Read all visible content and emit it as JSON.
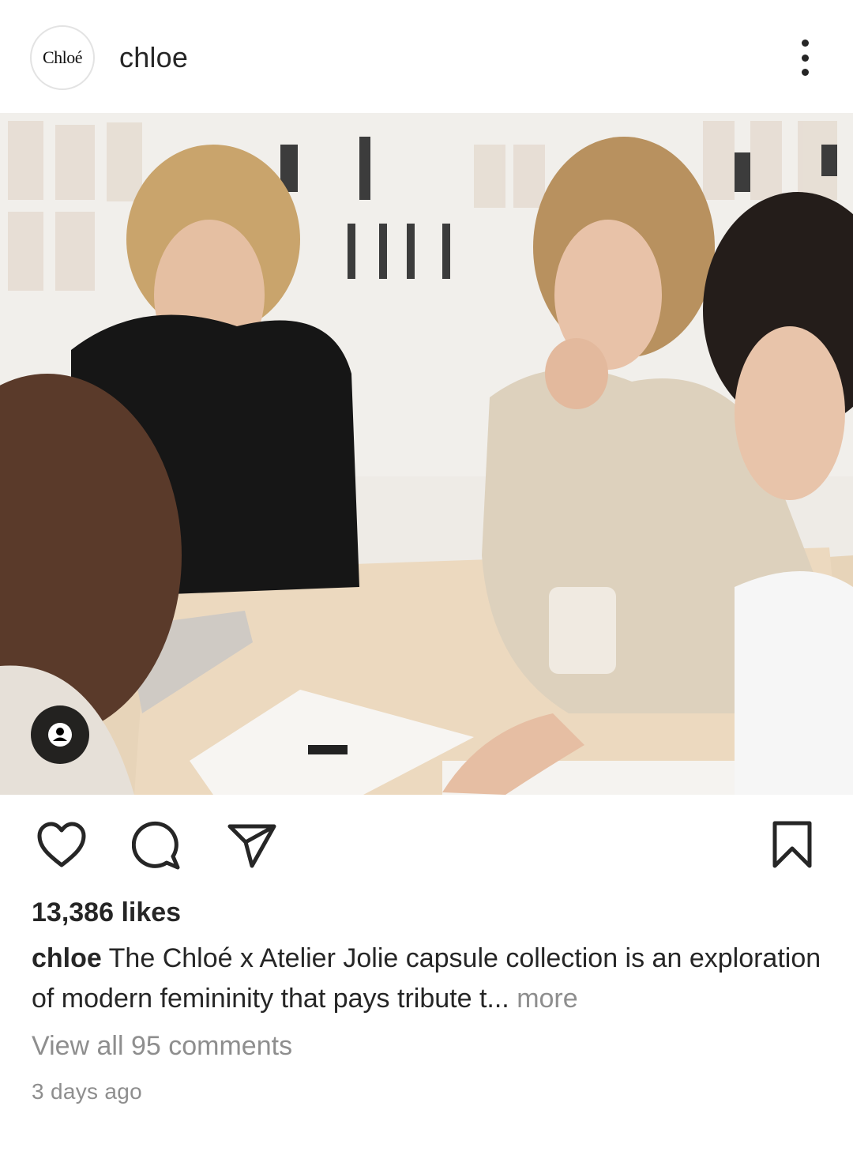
{
  "post": {
    "header": {
      "avatar_text": "Chloé",
      "username": "chloe",
      "more_icon": "more-vertical-icon"
    },
    "photo": {
      "tag_icon": "user-tag-icon"
    },
    "actions": {
      "like_icon": "heart-icon",
      "comment_icon": "comment-icon",
      "share_icon": "send-icon",
      "save_icon": "bookmark-icon"
    },
    "likes_text": "13,386 likes",
    "caption": {
      "username": "chloe",
      "text": "The Chloé x Atelier Jolie capsule collection is an exploration of modern femininity that pays tribute t...",
      "more_label": "more"
    },
    "view_comments": "View all 95 comments",
    "timestamp": "3 days ago"
  },
  "colors": {
    "text_primary": "#262626",
    "text_secondary": "#8e8e8e",
    "background": "#ffffff"
  }
}
